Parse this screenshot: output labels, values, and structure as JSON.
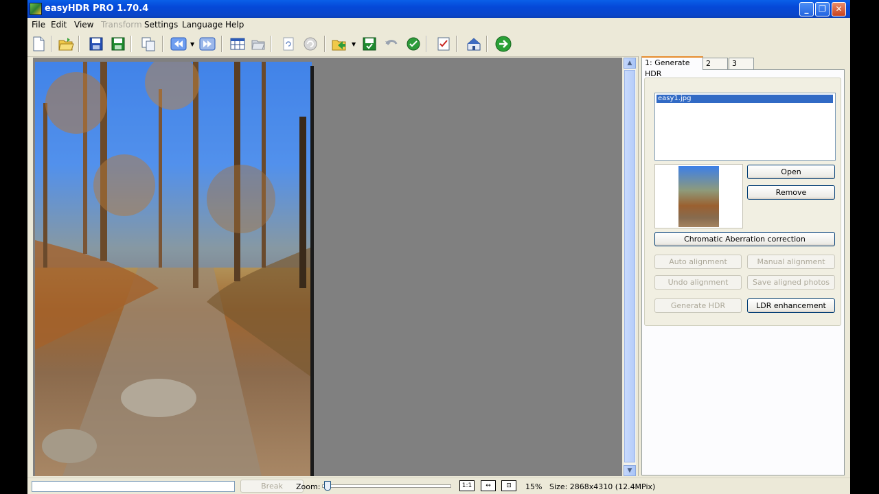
{
  "window": {
    "title": "easyHDR PRO 1.70.4",
    "minimize": "_",
    "maximize": "❐",
    "close": "✕"
  },
  "menu": {
    "items": [
      {
        "label": "File",
        "disabled": false
      },
      {
        "label": "Edit",
        "disabled": false
      },
      {
        "label": "View",
        "disabled": false
      },
      {
        "label": "Transform",
        "disabled": true
      },
      {
        "label": "Settings",
        "disabled": false
      },
      {
        "label": "Language",
        "disabled": false
      },
      {
        "label": "Help",
        "disabled": false
      }
    ]
  },
  "toolbar": {
    "icons": [
      "new-file",
      "open-folder",
      "save",
      "save-as",
      "copy",
      "back",
      "forward",
      "grid",
      "browse",
      "refresh",
      "undo",
      "export",
      "save-green",
      "revert",
      "apply",
      "checklist",
      "home",
      "go"
    ]
  },
  "tabs": [
    {
      "label": "1: Generate HDR",
      "active": true
    },
    {
      "label": "2",
      "active": false
    },
    {
      "label": "3",
      "active": false
    }
  ],
  "panel": {
    "file_list": [
      "easy1.jpg"
    ],
    "open_label": "Open",
    "remove_label": "Remove",
    "chromatic_label": "Chromatic Aberration correction",
    "auto_align_label": "Auto alignment",
    "manual_align_label": "Manual alignment",
    "undo_align_label": "Undo alignment",
    "save_aligned_label": "Save aligned photos",
    "generate_label": "Generate HDR",
    "ldr_label": "LDR enhancement"
  },
  "status": {
    "break_label": "Break",
    "zoom_label": "Zoom:",
    "zoom_value": "15%",
    "zoom_btn_1": "1:1",
    "zoom_btn_2": "↔",
    "zoom_btn_3": "⊡",
    "size_text": "Size: 2868x4310 (12.4MPix)"
  },
  "colors": {
    "titlebar": "#0548d8",
    "canvas": "#808080",
    "selection": "#316ac5"
  }
}
